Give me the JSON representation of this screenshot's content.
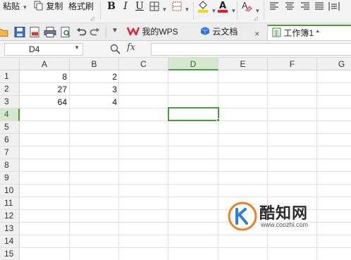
{
  "ribbon": {
    "paste_label": "粘贴",
    "copy_label": "复制",
    "format_painter_label": "格式刷",
    "bold_label": "B",
    "italic_label": "I",
    "underline_label": "U"
  },
  "tabs": [
    {
      "label": "我的WPS"
    },
    {
      "label": "云文档"
    },
    {
      "label": "工作簿1 *"
    }
  ],
  "formula_bar": {
    "name_box": "D4",
    "fx_label": "fx",
    "formula": ""
  },
  "grid": {
    "columns": [
      "A",
      "B",
      "C",
      "D",
      "E",
      "F",
      "G"
    ],
    "rows": [
      "1",
      "2",
      "3",
      "4",
      "5",
      "6",
      "7",
      "8",
      "9",
      "10",
      "11",
      "12",
      "13",
      "14",
      "15"
    ],
    "active_cell": "D4",
    "cells": {
      "a1": "8",
      "b1": "2",
      "a2": "27",
      "b2": "3",
      "a3": "64",
      "b3": "4"
    }
  },
  "watermark": {
    "brand": "酷知网",
    "url": "www.coozhi.com"
  },
  "colors": {
    "accent_green": "#4a9b3c",
    "wps_red": "#d9252b",
    "cloud_blue": "#2f6fd6",
    "watermark_orange": "#f07f21",
    "watermark_blue": "#2f7fd8"
  }
}
